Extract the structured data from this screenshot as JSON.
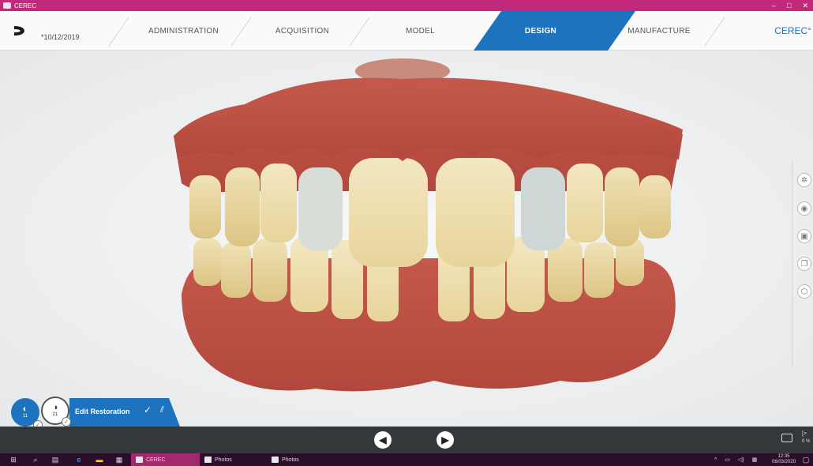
{
  "titlebar": {
    "app_name": "CEREC",
    "icon": "cerec-app-icon",
    "minimize": "–",
    "maximize": "□",
    "close": "✕"
  },
  "nav": {
    "logo_icon": "dentsply-logo-icon",
    "patient_date": "*10/12/2019",
    "steps": [
      {
        "label": "ADMINISTRATION",
        "active": false
      },
      {
        "label": "ACQUISITION",
        "active": false
      },
      {
        "label": "MODEL",
        "active": false
      },
      {
        "label": "DESIGN",
        "active": true
      },
      {
        "label": "MANUFACTURE",
        "active": false
      }
    ],
    "brand": "CEREC°",
    "accent": "#1e73be"
  },
  "right_tools": [
    {
      "icon": "tooth-circle-icon"
    },
    {
      "icon": "eye-icon"
    },
    {
      "icon": "image-frame-icon"
    },
    {
      "icon": "copy-layers-icon"
    },
    {
      "icon": "cube-icon"
    }
  ],
  "restoration_panel": {
    "teeth": [
      {
        "number": "11",
        "icon": "tooth-icon",
        "selected": true
      },
      {
        "number": "21",
        "icon": "tooth-icon",
        "selected": false
      }
    ],
    "edit_label": "Edit Restoration",
    "check_icon": "check-icon"
  },
  "bottombar": {
    "back_icon": "arrow-left-icon",
    "next_icon": "arrow-right-icon",
    "feedback_icon": "chat-icon",
    "progress_text": "0 %"
  },
  "taskbar": {
    "tasks": [
      {
        "label": "CEREC",
        "active": true
      },
      {
        "label": "Photos",
        "active": false
      },
      {
        "label": "Photos",
        "active": false
      }
    ],
    "time": "12:35",
    "date": "06/03/2020"
  }
}
